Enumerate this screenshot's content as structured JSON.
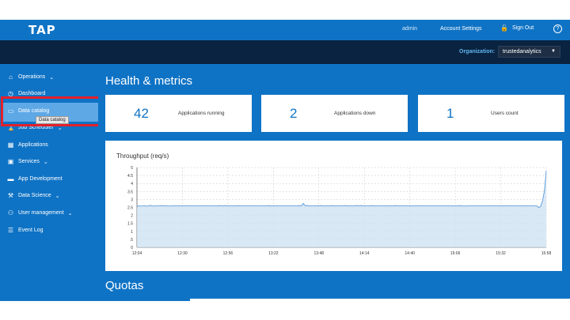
{
  "header": {
    "logo": "TAP",
    "admin": "admin",
    "account_settings": "Account Settings",
    "sign_out": "Sign Out",
    "help_icon": "?"
  },
  "org": {
    "label": "Organization:",
    "value": "trustedanalytics"
  },
  "sidebar": {
    "items": [
      {
        "label": "Operations",
        "icon": "tag-icon",
        "caret": "⌄"
      },
      {
        "label": "Dashboard",
        "icon": "clock-icon"
      },
      {
        "label": "Data catalog",
        "icon": "folder-icon"
      },
      {
        "label": "Job Scheduler",
        "icon": "hourglass-icon",
        "caret": "⌄"
      },
      {
        "label": "Applications",
        "icon": "grid-icon"
      },
      {
        "label": "Services",
        "icon": "bag-icon",
        "caret": "⌄"
      },
      {
        "label": "App Development",
        "icon": "monitor-icon"
      },
      {
        "label": "Data Science",
        "icon": "wrench-icon",
        "caret": "⌄"
      },
      {
        "label": "User management",
        "icon": "users-icon",
        "caret": "⌄"
      },
      {
        "label": "Event Log",
        "icon": "log-icon"
      }
    ],
    "tooltip": "Data catalog"
  },
  "main": {
    "title": "Health & metrics",
    "cards": [
      {
        "number": "42",
        "label": "Applications running"
      },
      {
        "number": "2",
        "label": "Applications down"
      },
      {
        "number": "1",
        "label": "Users count"
      }
    ],
    "quotas_title": "Quotas"
  },
  "chart_data": {
    "type": "area",
    "title": "Throughput (req/s)",
    "x": [
      "12:04",
      "12:30",
      "12:56",
      "13:22",
      "13:48",
      "14:14",
      "14:40",
      "15:06",
      "15:32",
      "15:58"
    ],
    "x_ticks": [
      "12:04",
      "12:30",
      "12:56",
      "13:22",
      "13:48",
      "14:14",
      "14:40",
      "15:06",
      "15:32",
      "15:58"
    ],
    "ylim": [
      0,
      5
    ],
    "y_ticks": [
      "0",
      ".5",
      "1",
      "1.5",
      "2",
      "2.5",
      "3",
      "3.5",
      "4",
      "4.5",
      "5"
    ],
    "series": [
      {
        "values": [
          2.55,
          2.6,
          2.58,
          2.6,
          2.6,
          2.58,
          2.6,
          2.62,
          2.6,
          2.58,
          2.6,
          2.6,
          2.6,
          2.62,
          2.6,
          2.6,
          2.6,
          2.58,
          2.6,
          2.6,
          2.6,
          2.6,
          2.6,
          2.6,
          2.6,
          2.6,
          2.6,
          2.6,
          2.6,
          2.6,
          2.6,
          2.6,
          2.6,
          2.6,
          2.6,
          2.6,
          2.6,
          2.6,
          2.6,
          2.6,
          2.6,
          2.6,
          2.6,
          2.62,
          2.6,
          2.6,
          2.62,
          2.6,
          2.6,
          2.6,
          2.6,
          2.6,
          2.6,
          2.62,
          2.6,
          2.6,
          2.6,
          2.6,
          2.6,
          2.6,
          2.6,
          2.6,
          2.6,
          2.6,
          2.6,
          2.6,
          2.6,
          2.6,
          2.6,
          2.62,
          2.6,
          2.6,
          2.6,
          2.6,
          2.6,
          2.6,
          2.6,
          2.6,
          2.6,
          2.6,
          2.6,
          2.6,
          2.6,
          2.6,
          2.6,
          2.62,
          2.6,
          2.75,
          2.6,
          2.62,
          2.6,
          2.6,
          2.6,
          2.6,
          2.6,
          2.6,
          2.62,
          2.6,
          2.6,
          2.6,
          2.6,
          2.6,
          2.62,
          2.6,
          2.6,
          2.6,
          2.6,
          2.6,
          2.6,
          2.62,
          2.6,
          2.6,
          2.6,
          2.6,
          2.6,
          2.62,
          2.6,
          2.62,
          2.6,
          2.6,
          2.6,
          2.6,
          2.6,
          2.62,
          2.6,
          2.6,
          2.6,
          2.6,
          2.6,
          2.6,
          2.6,
          2.6,
          2.6,
          2.6,
          2.6,
          2.62,
          2.6,
          2.6,
          2.6,
          2.6,
          2.6,
          2.6,
          2.6,
          2.6,
          2.6,
          2.6,
          2.6,
          2.6,
          2.6,
          2.6,
          2.6,
          2.6,
          2.6,
          2.6,
          2.6,
          2.6,
          2.6,
          2.6,
          2.6,
          2.6,
          2.6,
          2.6,
          2.6,
          2.6,
          2.6,
          2.6,
          2.6,
          2.6,
          2.6,
          2.62,
          2.6,
          2.58,
          2.6,
          2.6,
          2.6,
          2.6,
          2.6,
          2.6,
          2.6,
          2.6,
          2.6,
          2.6,
          2.6,
          2.6,
          2.6,
          2.6,
          2.6,
          2.6,
          2.6,
          2.6,
          2.6,
          2.6,
          2.6,
          2.6,
          2.6,
          2.6,
          2.6,
          2.6,
          2.6,
          2.6,
          2.6,
          2.6,
          2.6,
          2.6,
          2.6,
          2.6,
          2.6,
          2.6,
          2.6,
          2.6,
          2.5,
          2.55,
          2.9,
          3.5,
          4.8
        ]
      }
    ],
    "grid": true,
    "colors": {
      "line": "#4a90d9",
      "fill": "#cfe2f3"
    }
  },
  "colors": {
    "primary": "#0f73c5",
    "dark": "#0a2340",
    "highlight": "#e3202a"
  }
}
